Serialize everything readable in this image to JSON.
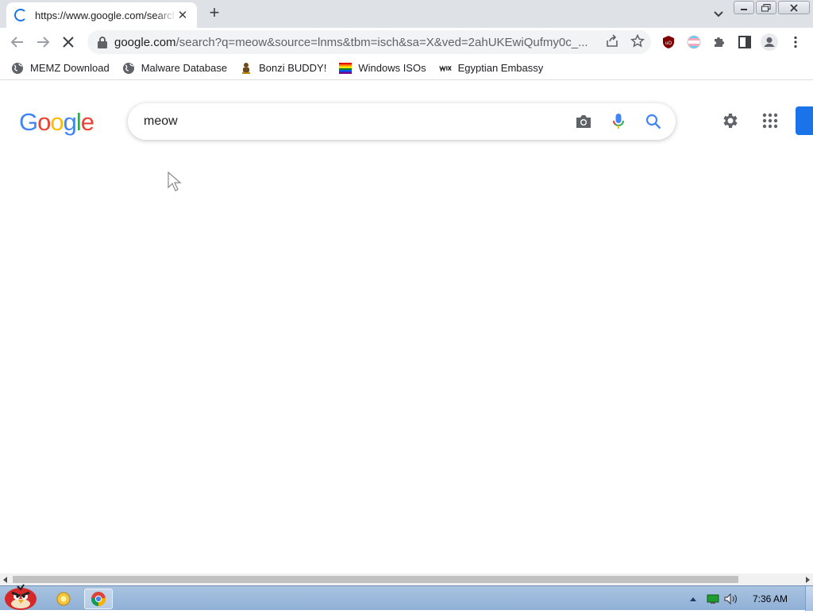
{
  "browser": {
    "tab_title": "https://www.google.com/search?q=meow",
    "tab_close": "✕",
    "new_tab": "+",
    "url_host": "google.com",
    "url_rest": "/search?q=meow&source=lnms&tbm=isch&sa=X&ved=2ahUKEwiQufmy0c_..."
  },
  "bookmarks": [
    {
      "label": "MEMZ Download",
      "icon": "globe-icon"
    },
    {
      "label": "Malware Database",
      "icon": "globe-icon"
    },
    {
      "label": "Bonzi BUDDY!",
      "icon": "bonzi-icon"
    },
    {
      "label": "Windows ISOs",
      "icon": "rainbow-flag-icon"
    },
    {
      "label": "Egyptian Embassy",
      "icon": "wix-icon"
    }
  ],
  "google": {
    "logo": [
      "G",
      "o",
      "o",
      "g",
      "l",
      "e"
    ],
    "logo_colors": [
      "#4285f4",
      "#ea4335",
      "#fbbc05",
      "#4285f4",
      "#34a853",
      "#ea4335"
    ],
    "query": "meow",
    "signin_color": "#1a73e8"
  },
  "taskbar": {
    "clock": "7:36 AM"
  }
}
